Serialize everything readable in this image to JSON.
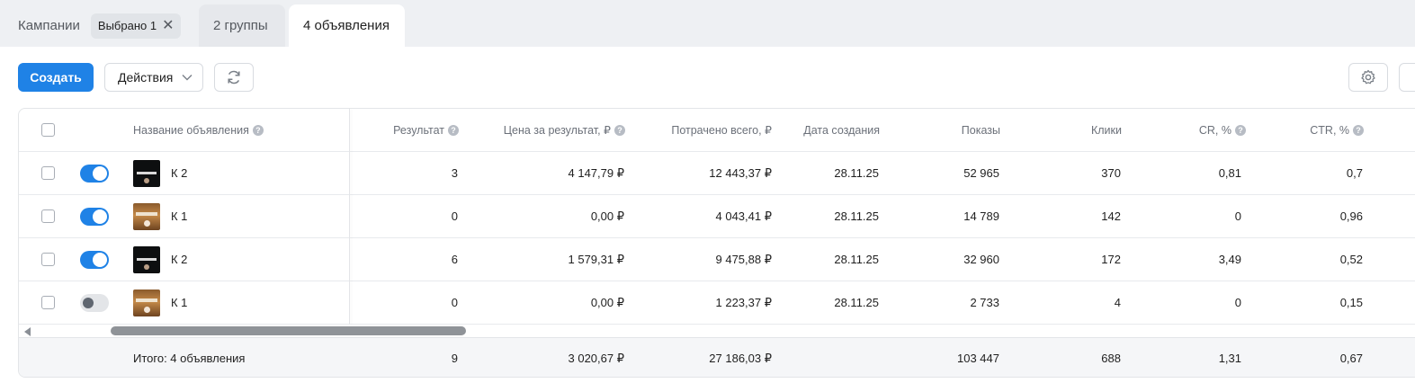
{
  "tabs": {
    "campaigns": "Кампании",
    "selected_chip": "Выбрано 1",
    "groups": "2 группы",
    "ads": "4 объявления"
  },
  "toolbar": {
    "create_label": "Создать",
    "actions_label": "Действия"
  },
  "table": {
    "headers": {
      "name": "Название объявления",
      "result": "Результат",
      "price_per_result": "Цена за результат, ₽",
      "spent_total": "Потрачено всего, ₽",
      "created": "Дата создания",
      "impressions": "Показы",
      "clicks": "Клики",
      "cr": "CR, %",
      "ctr": "CTR, %"
    },
    "rows": [
      {
        "enabled": true,
        "thumb": "dark",
        "name": "К 2",
        "result": "3",
        "price": "4 147,79 ₽",
        "spent": "12 443,37 ₽",
        "created": "28.11.25",
        "impressions": "52 965",
        "clicks": "370",
        "cr": "0,81",
        "ctr": "0,7"
      },
      {
        "enabled": true,
        "thumb": "brown",
        "name": "К 1",
        "result": "0",
        "price": "0,00 ₽",
        "spent": "4 043,41 ₽",
        "created": "28.11.25",
        "impressions": "14 789",
        "clicks": "142",
        "cr": "0",
        "ctr": "0,96"
      },
      {
        "enabled": true,
        "thumb": "dark",
        "name": "К 2",
        "result": "6",
        "price": "1 579,31 ₽",
        "spent": "9 475,88 ₽",
        "created": "28.11.25",
        "impressions": "32 960",
        "clicks": "172",
        "cr": "3,49",
        "ctr": "0,52"
      },
      {
        "enabled": false,
        "thumb": "brown",
        "name": "К 1",
        "result": "0",
        "price": "0,00 ₽",
        "spent": "1 223,37 ₽",
        "created": "28.11.25",
        "impressions": "2 733",
        "clicks": "4",
        "cr": "0",
        "ctr": "0,15"
      }
    ],
    "total": {
      "label": "Итого: 4 объявления",
      "result": "9",
      "price": "3 020,67 ₽",
      "spent": "27 186,03 ₽",
      "impressions": "103 447",
      "clicks": "688",
      "cr": "1,31",
      "ctr": "0,67"
    }
  },
  "colors": {
    "accent": "#1f82e6",
    "tab_bar": "#eef0f3"
  }
}
